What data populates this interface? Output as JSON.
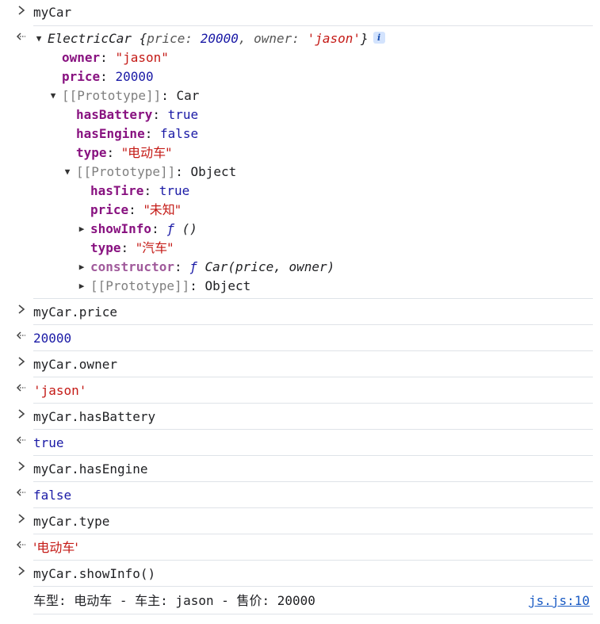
{
  "console": {
    "entries": [
      {
        "kind": "input",
        "text": "myCar"
      },
      {
        "kind": "output-object",
        "summary": {
          "class_name": "ElectricCar",
          "open_brace": "{",
          "k1": "price",
          "v1": "20000",
          "sep": ", ",
          "k2": "owner",
          "v2": "'jason'",
          "close_brace": "}",
          "info_icon": "i"
        },
        "own_props": [
          {
            "key": "owner",
            "value": "\"jason\"",
            "type": "string"
          },
          {
            "key": "price",
            "value": "20000",
            "type": "number"
          }
        ],
        "proto1": {
          "label": "[[Prototype]]",
          "value": "Car",
          "props": [
            {
              "key": "hasBattery",
              "value": "true",
              "type": "boolean"
            },
            {
              "key": "hasEngine",
              "value": "false",
              "type": "boolean"
            },
            {
              "key": "type",
              "value": "\"电动车\"",
              "type": "string"
            }
          ],
          "proto2": {
            "label": "[[Prototype]]",
            "value": "Object",
            "props": [
              {
                "key": "hasTire",
                "value": "true",
                "type": "boolean"
              },
              {
                "key": "price",
                "value": "\"未知\"",
                "type": "string"
              }
            ],
            "showInfo": {
              "key": "showInfo",
              "fn": "ƒ",
              "sig": "()"
            },
            "type_prop": {
              "key": "type",
              "value": "\"汽车\""
            },
            "constructor": {
              "key": "constructor",
              "fn": "ƒ",
              "sig": "Car(price, owner)"
            },
            "proto3": {
              "label": "[[Prototype]]",
              "value": "Object"
            }
          }
        }
      },
      {
        "kind": "input",
        "text": "myCar.price"
      },
      {
        "kind": "output",
        "text": "20000"
      },
      {
        "kind": "input",
        "text": "myCar.owner"
      },
      {
        "kind": "output",
        "text": "'jason'"
      },
      {
        "kind": "input",
        "text": "myCar.hasBattery"
      },
      {
        "kind": "output",
        "text": "true"
      },
      {
        "kind": "input",
        "text": "myCar.hasEngine"
      },
      {
        "kind": "output",
        "text": "false"
      },
      {
        "kind": "input",
        "text": "myCar.type"
      },
      {
        "kind": "output",
        "text": "'电动车'"
      },
      {
        "kind": "input",
        "text": "myCar.showInfo()"
      },
      {
        "kind": "log",
        "text": "车型: 电动车 - 车主: jason - 售价: 20000",
        "source": "js.js:10"
      }
    ]
  },
  "colors": {
    "key": "#881280",
    "string": "#c41a16",
    "number": "#1a1aa6",
    "internal": "#7f7f7f",
    "link": "#1a5bc4",
    "divider": "#dfe3e8",
    "info_badge_bg": "#d3e3fd"
  },
  "icons": {
    "input_prompt": "chevron-right-icon",
    "output_prompt": "return-arrow-icon",
    "expanded": "triangle-down-icon",
    "collapsed": "triangle-right-icon",
    "info": "info-icon"
  },
  "glyphs": {
    "expanded": "▼",
    "collapsed": "▶",
    "colon": ": "
  }
}
